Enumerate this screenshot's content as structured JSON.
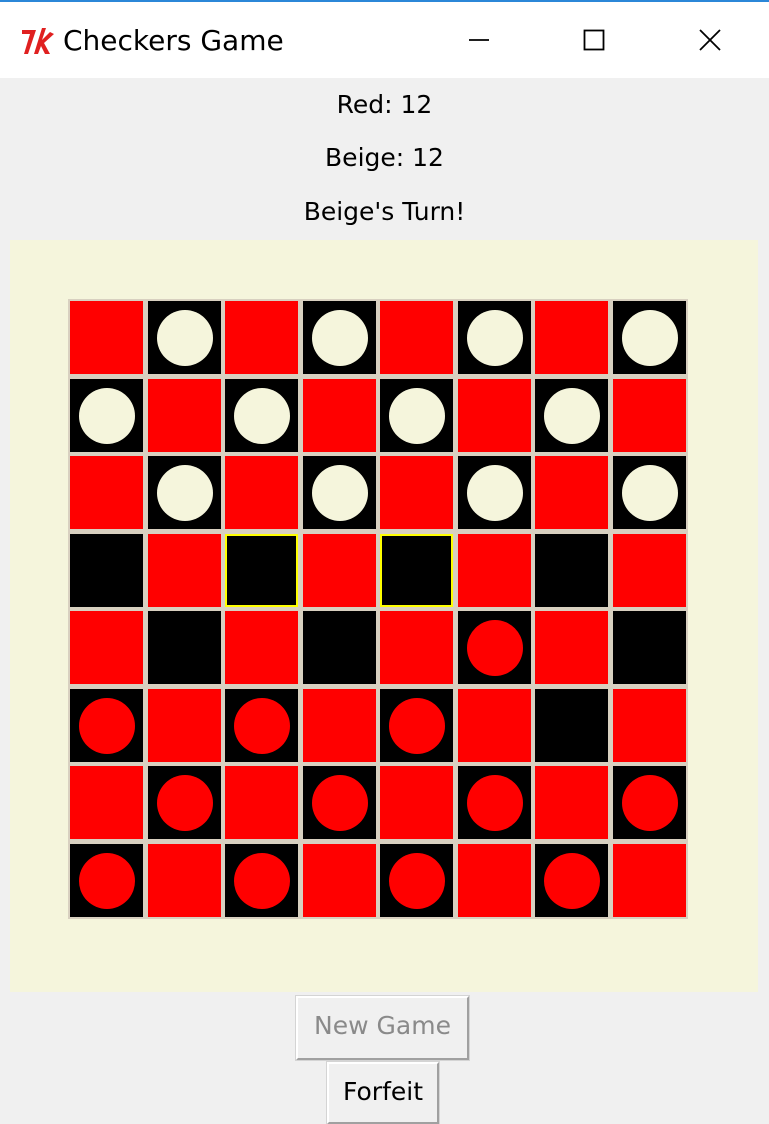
{
  "window": {
    "title": "Checkers Game",
    "icon": "tk-feather-icon"
  },
  "score": {
    "red": "Red: 12",
    "beige": "Beige: 12"
  },
  "status": {
    "turn": "Beige's Turn!"
  },
  "board": {
    "rows": 8,
    "cols": 8,
    "squares": [
      [
        "R",
        "B",
        "R",
        "B",
        "R",
        "B",
        "R",
        "B"
      ],
      [
        "B",
        "R",
        "B",
        "R",
        "B",
        "R",
        "B",
        "R"
      ],
      [
        "R",
        "B",
        "R",
        "B",
        "R",
        "B",
        "R",
        "B"
      ],
      [
        "B",
        "R",
        "B",
        "R",
        "B",
        "R",
        "B",
        "R"
      ],
      [
        "R",
        "B",
        "R",
        "B",
        "R",
        "B",
        "R",
        "B"
      ],
      [
        "B",
        "R",
        "B",
        "R",
        "B",
        "R",
        "B",
        "R"
      ],
      [
        "R",
        "B",
        "R",
        "B",
        "R",
        "B",
        "R",
        "B"
      ],
      [
        "B",
        "R",
        "B",
        "R",
        "B",
        "R",
        "B",
        "R"
      ]
    ],
    "pieces": [
      [
        "",
        "beige",
        "",
        "beige",
        "",
        "beige",
        "",
        "beige"
      ],
      [
        "beige",
        "",
        "beige",
        "",
        "beige",
        "",
        "beige",
        ""
      ],
      [
        "",
        "beige",
        "",
        "beige",
        "",
        "beige",
        "",
        "beige"
      ],
      [
        "",
        "",
        "",
        "",
        "",
        "",
        "",
        ""
      ],
      [
        "",
        "",
        "",
        "",
        "",
        "red",
        "",
        ""
      ],
      [
        "red",
        "",
        "red",
        "",
        "red",
        "",
        "",
        ""
      ],
      [
        "",
        "red",
        "",
        "red",
        "",
        "red",
        "",
        "red"
      ],
      [
        "red",
        "",
        "red",
        "",
        "red",
        "",
        "red",
        ""
      ]
    ],
    "highlighted": [
      [
        3,
        2
      ],
      [
        3,
        4
      ]
    ],
    "colors": {
      "red_square": "#ff0000",
      "black_square": "#000000",
      "beige_piece": "#f5f5dc",
      "red_piece": "#ff0000",
      "highlight": "#ffff00",
      "frame": "#f5f5dc"
    }
  },
  "buttons": {
    "new_game": "New Game",
    "new_game_enabled": false,
    "forfeit": "Forfeit"
  }
}
